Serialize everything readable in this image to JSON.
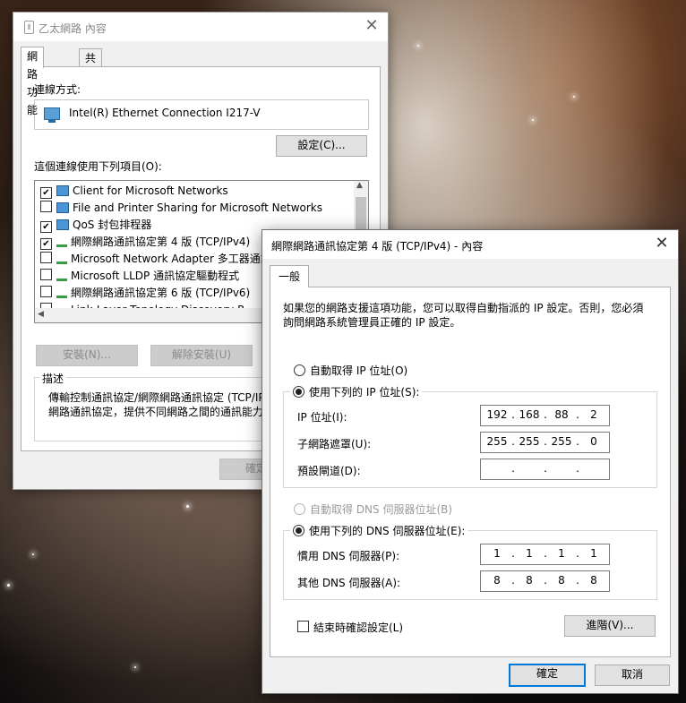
{
  "back_window": {
    "title": "乙太網路 內容",
    "tabs": [
      "網路功能",
      "共用"
    ],
    "connect_using_label": "連線方式:",
    "adapter_name": "Intel(R) Ethernet Connection I217-V",
    "configure_button": "設定(C)...",
    "items_label": "這個連線使用下列項目(O):",
    "items": [
      {
        "label": "Client for Microsoft Networks",
        "checked": true,
        "icon": "network-client-icon"
      },
      {
        "label": "File and Printer Sharing for Microsoft Networks",
        "checked": false,
        "icon": "network-client-icon"
      },
      {
        "label": "QoS 封包排程器",
        "checked": true,
        "icon": "network-client-icon"
      },
      {
        "label": "網際網路通訊協定第 4 版 (TCP/IPv4)",
        "checked": true,
        "icon": "protocol-icon"
      },
      {
        "label": "Microsoft Network Adapter 多工器通訊",
        "checked": false,
        "icon": "protocol-icon"
      },
      {
        "label": "Microsoft LLDP 通訊協定驅動程式",
        "checked": false,
        "icon": "protocol-icon"
      },
      {
        "label": "網際網路通訊協定第 6 版 (TCP/IPv6)",
        "checked": false,
        "icon": "protocol-icon"
      },
      {
        "label": "Link-Layer Topology Discovery R",
        "checked": false,
        "icon": "protocol-icon"
      }
    ],
    "install_button": "安裝(N)...",
    "uninstall_button": "解除安裝(U)",
    "description_legend": "描述",
    "description_text_1": "傳輸控制通訊協定/網際網路通訊協定 (TCP/IP",
    "description_text_2": "網路通訊協定，提供不同網路之間的通訊能力",
    "ok_button": "確定"
  },
  "dialog": {
    "title": "網際網路通訊協定第 4 版 (TCP/IPv4) - 內容",
    "tab": "一般",
    "intro_line_1": "如果您的網路支援這項功能，您可以取得自動指派的 IP 設定。否則，您必須",
    "intro_line_2": "詢問網路系統管理員正確的 IP 設定。",
    "auto_ip": "自動取得 IP 位址(O)",
    "manual_ip": "使用下列的 IP 位址(S):",
    "ip_label": "IP 位址(I):",
    "subnet_label": "子網路遮罩(U):",
    "gateway_label": "預設閘道(D):",
    "ip": [
      "192",
      "168",
      "88",
      "2"
    ],
    "subnet": [
      "255",
      "255",
      "255",
      "0"
    ],
    "gateway": [
      "",
      "",
      "",
      ""
    ],
    "auto_dns": "自動取得 DNS 伺服器位址(B)",
    "manual_dns": "使用下列的 DNS 伺服器位址(E):",
    "preferred_dns_label": "慣用 DNS 伺服器(P):",
    "alternate_dns_label": "其他 DNS 伺服器(A):",
    "preferred_dns": [
      "1",
      "1",
      "1",
      "1"
    ],
    "alternate_dns": [
      "8",
      "8",
      "8",
      "8"
    ],
    "validate_label": "結束時確認設定(L)",
    "advanced_button": "進階(V)...",
    "ok_button": "確定",
    "cancel_button": "取消"
  },
  "colors": {
    "accent": "#0078d7"
  }
}
